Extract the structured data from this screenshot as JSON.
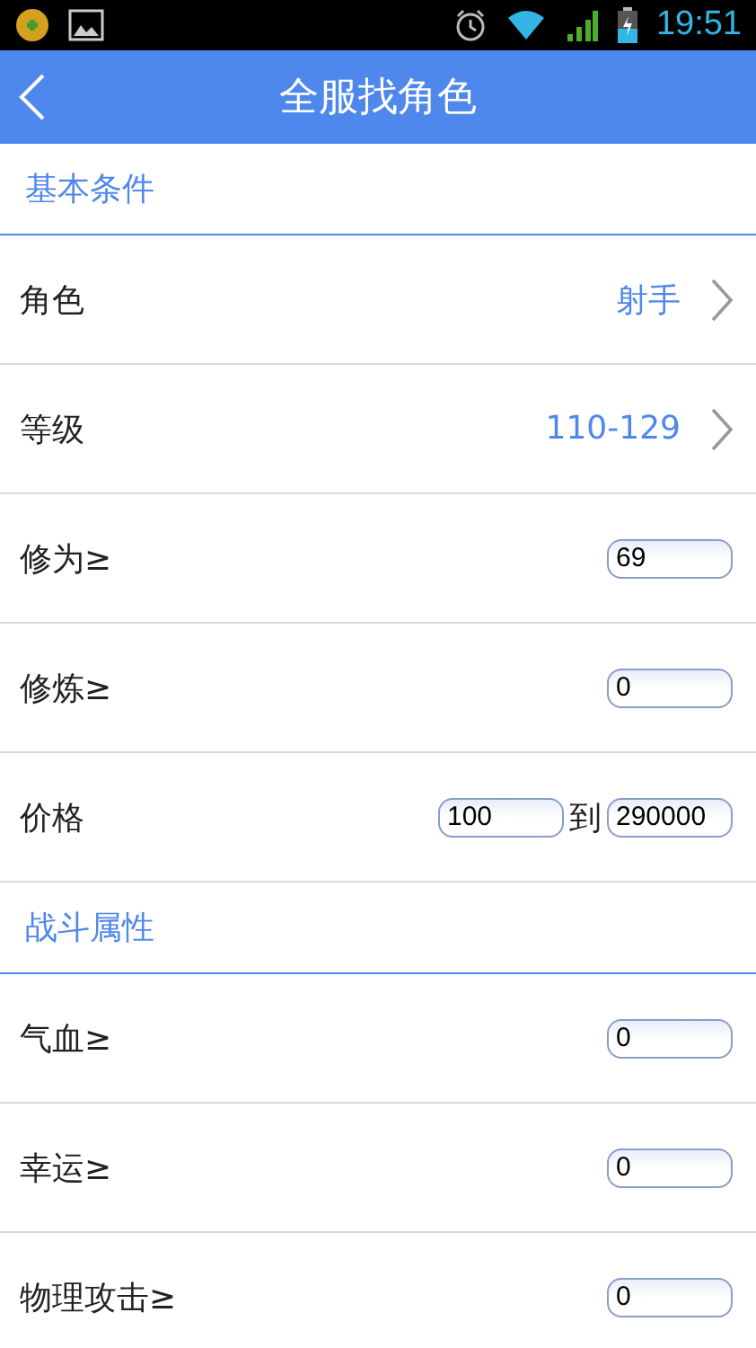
{
  "status_bar": {
    "time": "19:51"
  },
  "header": {
    "title": "全服找角色"
  },
  "sections": [
    {
      "title": "基本条件",
      "rows": [
        {
          "kind": "select",
          "label": "角色",
          "value": "射手"
        },
        {
          "kind": "select",
          "label": "等级",
          "value": "110-129"
        },
        {
          "kind": "number",
          "label": "修为≥",
          "value": "69"
        },
        {
          "kind": "number",
          "label": "修炼≥",
          "value": "0"
        },
        {
          "kind": "range",
          "label": "价格",
          "from": "100",
          "separator": "到",
          "to": "290000"
        }
      ]
    },
    {
      "title": "战斗属性",
      "rows": [
        {
          "kind": "number",
          "label": "气血≥",
          "value": "0"
        },
        {
          "kind": "number",
          "label": "幸运≥",
          "value": "0"
        },
        {
          "kind": "number",
          "label": "物理攻击≥",
          "value": "0"
        }
      ]
    }
  ]
}
